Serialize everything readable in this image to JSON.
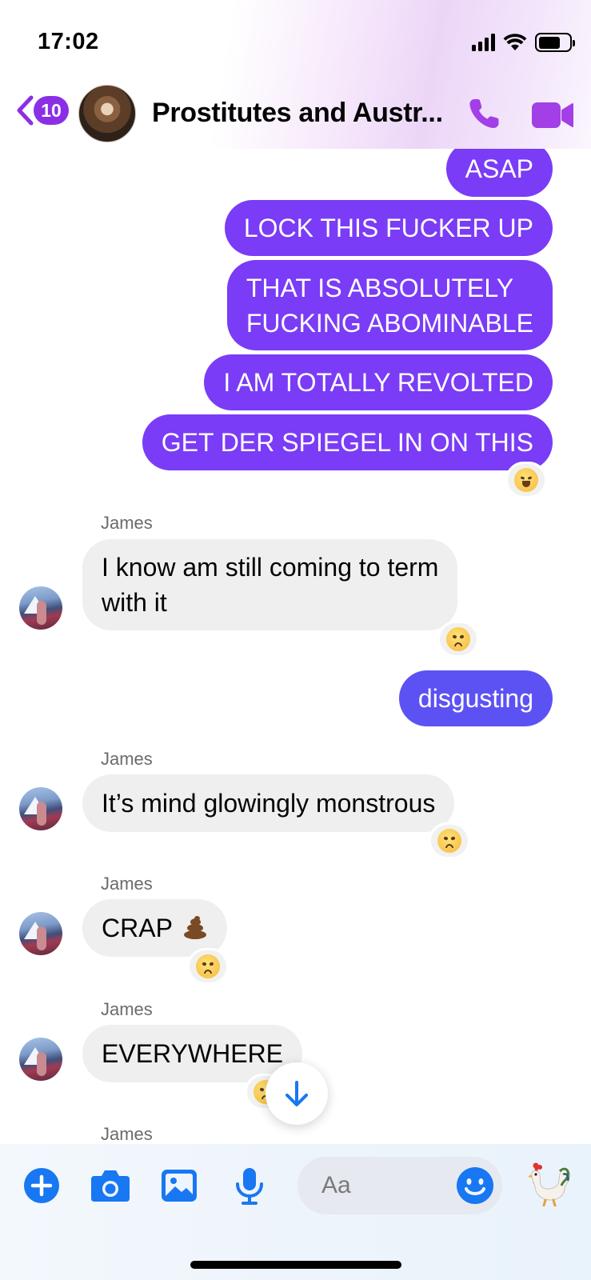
{
  "status_bar": {
    "time": "17:02"
  },
  "header": {
    "back_count": "10",
    "title": "Prostitutes and Austr...",
    "icons": {
      "back": "chevron-left-icon",
      "call": "phone-icon",
      "video": "video-camera-icon"
    }
  },
  "messages": {
    "m1": "ASAP",
    "m2": "LOCK THIS FUCKER UP",
    "m3_line1": "THAT IS ABSOLUTELY",
    "m3_line2": "FUCKING ABOMINABLE",
    "m4": "I AM TOTALLY REVOLTED",
    "m5": "GET DER SPIEGEL IN ON THIS",
    "m5_reaction": "laughing-face",
    "m6_sender": "James",
    "m6_line1": "I know am still coming to term",
    "m6_line2": "with it",
    "m6_reaction": "angry-face",
    "m7": "disgusting",
    "m8_sender": "James",
    "m8": "It’s mind glowingly monstrous",
    "m8_reaction": "angry-face",
    "m9_sender": "James",
    "m9": "CRAP",
    "m9_emoji": "pile-of-poo",
    "m9_reaction": "angry-face",
    "m10_sender": "James",
    "m10": "EVERYWHERE",
    "m10_reaction": "angry-face",
    "m11_sender": "James"
  },
  "composer": {
    "placeholder": "Aa",
    "icons": [
      "plus-icon",
      "camera-icon",
      "gallery-icon",
      "microphone-icon",
      "emoji-icon",
      "rooster-icon"
    ]
  },
  "colors": {
    "outgoing_purple": "#7a3cf6",
    "outgoing_blue": "#5c52f4",
    "incoming_gray": "#efefef",
    "header_accent": "#8b2fe6",
    "composer_blue": "#1877f2"
  }
}
